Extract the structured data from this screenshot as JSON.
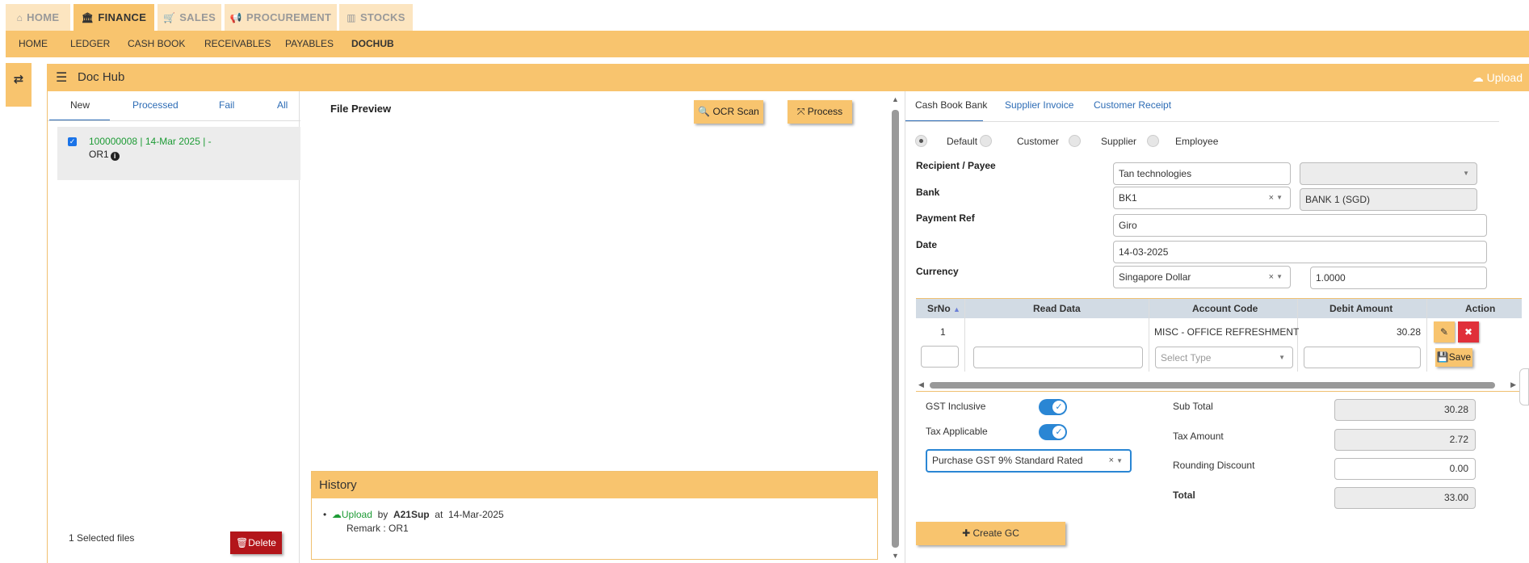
{
  "top_tabs": [
    {
      "label": "HOME",
      "icon": "home-icon",
      "glyph": "⌂"
    },
    {
      "label": "FINANCE",
      "icon": "bank-icon",
      "glyph": "🏛"
    },
    {
      "label": "SALES",
      "icon": "cart-icon",
      "glyph": "🛒"
    },
    {
      "label": "PROCUREMENT",
      "icon": "megaphone-icon",
      "glyph": "📢"
    },
    {
      "label": "STOCKS",
      "icon": "bar-chart-icon",
      "glyph": "▥"
    }
  ],
  "sub_nav": [
    "HOME",
    "LEDGER",
    "CASH BOOK",
    "RECEIVABLES",
    "PAYABLES",
    "DOCHUB"
  ],
  "panel": {
    "title": "Doc Hub",
    "upload_label": "Upload"
  },
  "left": {
    "tabs": [
      "New",
      "Processed",
      "Fail",
      "All"
    ],
    "file": {
      "line1": "100000008 | 14-Mar 2025 | -",
      "line2": "OR1"
    },
    "selected_count": "1 Selected files",
    "delete_label": "Delete"
  },
  "middle": {
    "title": "File Preview",
    "ocr_label": "OCR Scan",
    "process_label": "Process",
    "history": {
      "title": "History",
      "action": "Upload",
      "by_label": "by",
      "user": "A21Sup",
      "at_label": "at",
      "date": "14-Mar-2025",
      "remark": "Remark : OR1"
    }
  },
  "right": {
    "tabs": [
      "Cash Book Bank",
      "Supplier Invoice",
      "Customer Receipt"
    ],
    "radios": [
      "Default",
      "Customer",
      "Supplier",
      "Employee"
    ],
    "fields": {
      "recipient_label": "Recipient / Payee",
      "recipient_value": "Tan technologies",
      "bank_label": "Bank",
      "bank_value": "BK1",
      "bank_name": "BANK 1 (SGD)",
      "payment_ref_label": "Payment Ref",
      "payment_ref_value": "Giro",
      "date_label": "Date",
      "date_value": "14-03-2025",
      "currency_label": "Currency",
      "currency_value": "Singapore Dollar",
      "rate_value": "1.0000"
    },
    "grid": {
      "headers": [
        "SrNo",
        "Read Data",
        "Account Code",
        "Debit Amount",
        "Action"
      ],
      "row": {
        "srno": "1",
        "account": "MISC - OFFICE REFRESHMENT",
        "amount": "30.28"
      },
      "select_placeholder": "Select Type",
      "save_label": "Save"
    },
    "gst_inclusive_label": "GST Inclusive",
    "tax_applicable_label": "Tax Applicable",
    "tax_code": "Purchase GST 9% Standard Rated",
    "totals": {
      "sub_total_label": "Sub Total",
      "sub_total": "30.28",
      "tax_amount_label": "Tax Amount",
      "tax_amount": "2.72",
      "rounding_label": "Rounding Discount",
      "rounding": "0.00",
      "total_label": "Total",
      "total": "33.00"
    },
    "create_label": "Create GC"
  },
  "colors": {
    "accent": "#f8c46e",
    "link": "#2d6cb5",
    "delete": "#b3151a",
    "toggle": "#2a86d4"
  }
}
